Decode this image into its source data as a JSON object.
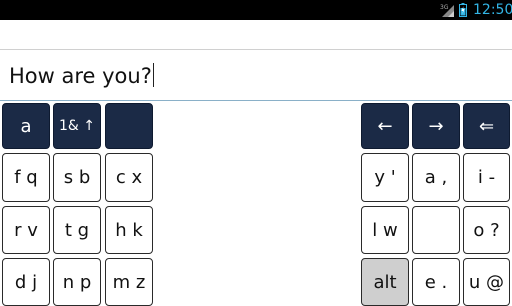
{
  "status_bar": {
    "network": "3G",
    "time": "12:50",
    "signal_icon": "signal-icon",
    "battery_icon": "battery-icon"
  },
  "text_field": {
    "value": "How are you?"
  },
  "keyboard": {
    "row1": {
      "left": [
        {
          "label": "a"
        },
        {
          "label": "1& ↑"
        },
        {
          "label": ""
        }
      ],
      "right": [
        {
          "label": "←"
        },
        {
          "label": "→"
        },
        {
          "label": "⇐"
        }
      ]
    },
    "row2": {
      "left": [
        {
          "label": "f q"
        },
        {
          "label": "s b"
        },
        {
          "label": "c x"
        }
      ],
      "right": [
        {
          "label": "y '"
        },
        {
          "label": "a ,"
        },
        {
          "label": "i -"
        }
      ]
    },
    "row3": {
      "left": [
        {
          "label": "r v"
        },
        {
          "label": "t g"
        },
        {
          "label": "h k"
        }
      ],
      "right": [
        {
          "label": "l w"
        },
        {
          "label": ""
        },
        {
          "label": "o ?"
        }
      ]
    },
    "row4": {
      "left": [
        {
          "label": "d j"
        },
        {
          "label": "n p"
        },
        {
          "label": "m z"
        }
      ],
      "right": [
        {
          "label": "alt"
        },
        {
          "label": "e ."
        },
        {
          "label": "u @"
        }
      ]
    }
  },
  "colors": {
    "dark_key": "#1b2a46",
    "status_accent": "#33b5e5",
    "alt_key": "#cfcfcf"
  }
}
